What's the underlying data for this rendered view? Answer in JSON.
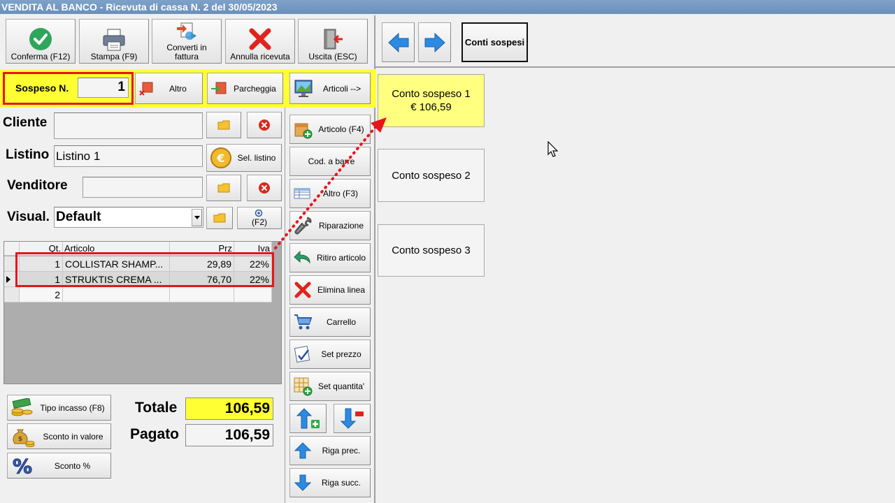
{
  "window": {
    "title": "VENDITA AL BANCO - Ricevuta di cassa N. 2 del 30/05/2023"
  },
  "toolbar": {
    "confirm": "Conferma (F12)",
    "print": "Stampa (F9)",
    "convert_1": "Converti in",
    "convert_2": "fattura",
    "cancel": "Annulla ricevuta",
    "exit": "Uscita (ESC)"
  },
  "suspend": {
    "label": "Sospeso N.",
    "number": "1",
    "other": "Altro",
    "park": "Parcheggia",
    "articles": "Articoli -->"
  },
  "form": {
    "client_label": "Cliente",
    "client_value": "",
    "pricelist_label": "Listino",
    "pricelist_value": "Listino 1",
    "pricelist_button": "Sel. listino",
    "seller_label": "Venditore",
    "seller_value": "",
    "view_label": "Visual.",
    "view_value": "Default",
    "view_f2": "(F2)"
  },
  "grid": {
    "headers": {
      "qty": "Qt.",
      "article": "Articolo",
      "price": "Prz",
      "vat": "Iva"
    },
    "rows": [
      {
        "qty": "1",
        "article": "COLLISTAR SHAMP...",
        "price": "29,89",
        "vat": "22%"
      },
      {
        "qty": "1",
        "article": "STRUKTIS CREMA ...",
        "price": "76,70",
        "vat": "22%"
      },
      {
        "qty": "2",
        "article": "",
        "price": "",
        "vat": ""
      }
    ]
  },
  "bottom": {
    "payment_type": "Tipo incasso (F8)",
    "discount_value": "Sconto in valore",
    "discount_pct": "Sconto %",
    "total_label": "Totale",
    "total_value": "106,59",
    "paid_label": "Pagato",
    "paid_value": "106,59"
  },
  "side": {
    "article_f4": "Articolo (F4)",
    "barcode": "Cod. a barre",
    "other_f3": "Altro (F3)",
    "repair": "Riparazione",
    "return_article": "Ritiro articolo",
    "delete_line": "Elimina linea",
    "cart": "Carrello",
    "set_price": "Set prezzo",
    "set_qty": "Set quantita'",
    "prev_row": "Riga prec.",
    "next_row": "Riga succ."
  },
  "right": {
    "suspended_button": "Conti sospesi",
    "cards": [
      {
        "name": "Conto sospeso 1",
        "amount": "€ 106,59"
      },
      {
        "name": "Conto sospeso 2",
        "amount": ""
      },
      {
        "name": "Conto sospeso 3",
        "amount": ""
      }
    ]
  },
  "colors": {
    "highlight_yellow": "#ffff33",
    "annotation_red": "#e8141c",
    "titlebar": "#7399c3"
  }
}
